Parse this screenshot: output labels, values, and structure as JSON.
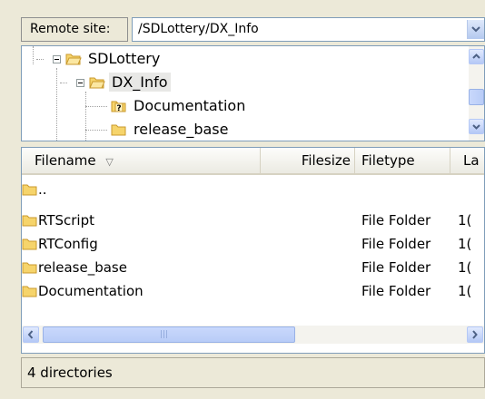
{
  "remote_site": {
    "label": "Remote site:",
    "path": "/SDLottery/DX_Info"
  },
  "tree": {
    "items": [
      {
        "label": "SDLottery",
        "icon": "folder-open-icon"
      },
      {
        "label": "DX_Info",
        "icon": "folder-open-icon",
        "selected": true
      },
      {
        "label": "Documentation",
        "icon": "folder-unknown-icon"
      },
      {
        "label": "release_base",
        "icon": "folder-icon"
      }
    ]
  },
  "file_list": {
    "columns": [
      "Filename",
      "Filesize",
      "Filetype",
      "La"
    ],
    "sort_indicator": "▽",
    "rows": [
      {
        "name": "..",
        "type": "",
        "last": ""
      },
      {
        "name": "RTScript",
        "type": "File Folder",
        "last": "1("
      },
      {
        "name": "RTConfig",
        "type": "File Folder",
        "last": "1("
      },
      {
        "name": "release_base",
        "type": "File Folder",
        "last": "1("
      },
      {
        "name": "Documentation",
        "type": "File Folder",
        "last": "1("
      }
    ]
  },
  "hscroll": {
    "thumb_grip": "|||"
  },
  "status": {
    "text": "4 directories"
  },
  "colors": {
    "folder": "#f6d46b",
    "folder_stroke": "#c99a2e",
    "panel_border": "#7f9db9",
    "scroll_button": "#b4c8f6"
  }
}
